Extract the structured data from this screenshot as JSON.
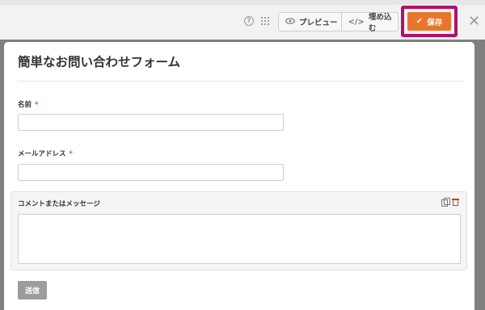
{
  "toolbar": {
    "help_icon": "question-circle-icon",
    "grid_icon": "drag-grid-icon",
    "preview_label": "プレビュー",
    "preview_icon": "eye-icon",
    "embed_label": "埋め込む",
    "embed_icon": "code-icon",
    "save_label": "保存",
    "save_icon": "check-icon",
    "close_icon": "close-icon"
  },
  "colors": {
    "save": "#e8762a",
    "highlight": "#b0126b",
    "required": "#d9534f",
    "delete": "#d9381e"
  },
  "form": {
    "title": "簡単なお問い合わせフォーム",
    "fields": [
      {
        "label": "名前",
        "required_mark": "*",
        "value": ""
      },
      {
        "label": "メールアドレス",
        "required_mark": "*",
        "value": ""
      },
      {
        "label": "コメントまたはメッセージ",
        "value": ""
      }
    ],
    "submit_label": "送信"
  }
}
